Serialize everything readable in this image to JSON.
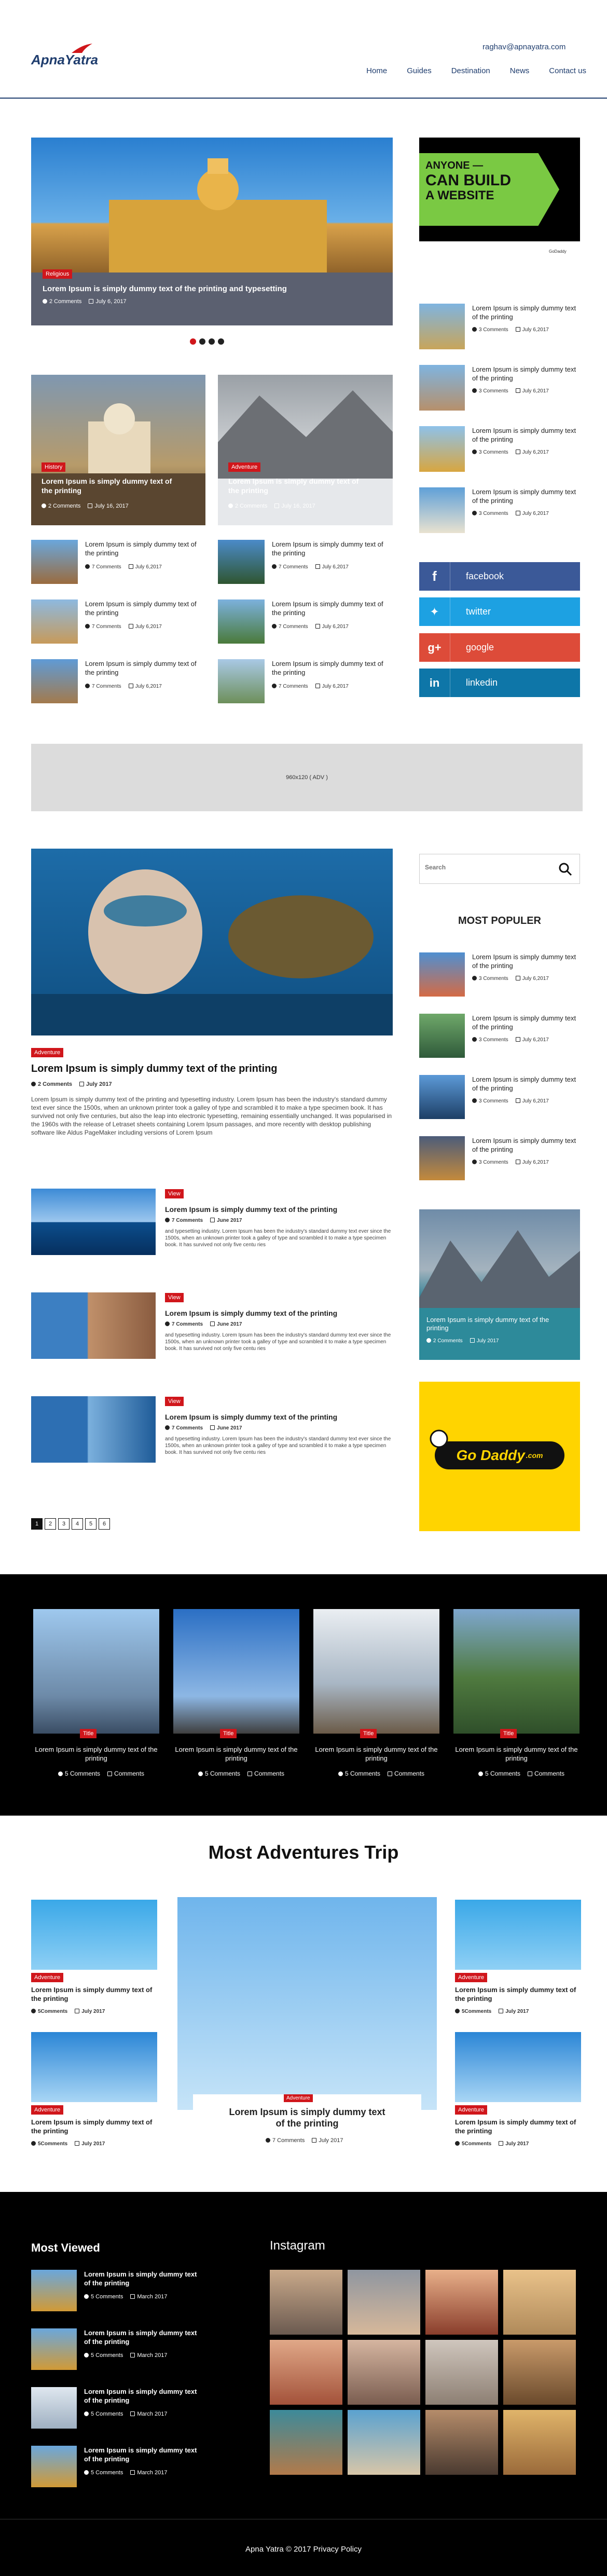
{
  "header": {
    "logo_a": "Apna",
    "logo_b": "Yatra",
    "email": "raghav@apnayatra.com",
    "nav": [
      "Home",
      "Guides",
      "Destination",
      "News",
      "Contact us"
    ]
  },
  "hero": {
    "badge": "Religious",
    "title": "Lorem Ipsum is simply dummy text of the printing and typesetting",
    "comments": "2 Comments",
    "date": "July 6, 2017"
  },
  "ad_build": {
    "line1": "ANYONE —",
    "line2": "CAN BUILD",
    "line3": "A WEBSITE",
    "brand": "GoDaddy"
  },
  "side_list": [
    {
      "title": "Lorem Ipsum is simply dummy text of the printing",
      "comments": "3 Comments",
      "date": "July 6,2017"
    },
    {
      "title": "Lorem Ipsum is simply dummy text of the printing",
      "comments": "3 Comments",
      "date": "July 6,2017"
    },
    {
      "title": "Lorem Ipsum is simply dummy text of the printing",
      "comments": "3 Comments",
      "date": "July 6,2017"
    },
    {
      "title": "Lorem Ipsum is simply dummy text of the printing",
      "comments": "3 Comments",
      "date": "July 6,2017"
    }
  ],
  "feature_cards": [
    {
      "badge": "History",
      "title": "Lorem Ipsum is simply dummy text of the printing",
      "comments": "2 Comments",
      "date": "July 16, 2017"
    },
    {
      "badge": "Adventure",
      "title": "Lorem Ipsum is simply dummy text of the printing",
      "comments": "2 Comments",
      "date": "July 16, 2017"
    }
  ],
  "small_grid": [
    {
      "title": "Lorem Ipsum is simply dummy text of the printing",
      "comments": "7 Comments",
      "date": "July 6,2017"
    },
    {
      "title": "Lorem Ipsum is simply dummy text of the printing",
      "comments": "7 Comments",
      "date": "July 6,2017"
    },
    {
      "title": "Lorem Ipsum is simply dummy text of the printing",
      "comments": "7 Comments",
      "date": "July 6,2017"
    },
    {
      "title": "Lorem Ipsum is simply dummy text of the printing",
      "comments": "7 Comments",
      "date": "July 6,2017"
    },
    {
      "title": "Lorem Ipsum is simply dummy text of the printing",
      "comments": "7 Comments",
      "date": "July 6,2017"
    },
    {
      "title": "Lorem Ipsum is simply dummy text of the printing",
      "comments": "7 Comments",
      "date": "July 6,2017"
    }
  ],
  "social": [
    "facebook",
    "twitter",
    "google",
    "linkedin"
  ],
  "ad_banner": "960x120 ( ADV )",
  "article": {
    "badge": "Adventure",
    "title": "Lorem Ipsum is simply dummy text of the printing",
    "comments": "2 Comments",
    "date": "July 2017",
    "body": "Lorem Ipsum is simply dummy text of the printing and typesetting industry. Lorem Ipsum has been the industry's standard dummy text ever since the 1500s, when an unknown printer took a galley of type and scrambled it to make a type specimen book. It has survived not only five centuries, but also the leap into electronic typesetting, remaining essentially unchanged. It was popularised in the 1960s with the release of Letraset sheets containing Lorem Ipsum passages, and more recently with desktop publishing software like Aldus PageMaker including versions of Lorem Ipsum"
  },
  "list_articles": [
    {
      "badge": "View",
      "title": "Lorem Ipsum is simply dummy text of the printing",
      "comments": "7 Comments",
      "date": "June 2017",
      "body": "and typesetting industry. Lorem Ipsum has been the industry's standard dummy text ever since the 1500s, when an unknown printer took a galley of type and scrambled it to make a type specimen book. It has survived not only five centu ries"
    },
    {
      "badge": "View",
      "title": "Lorem Ipsum is simply dummy text of the printing",
      "comments": "7 Comments",
      "date": "June 2017",
      "body": "and typesetting industry. Lorem Ipsum has been the industry's standard dummy text ever since the 1500s, when an unknown printer took a galley of type and scrambled it to make a type specimen book. It has survived not only five centu ries"
    },
    {
      "badge": "View",
      "title": "Lorem Ipsum is simply dummy text of the printing",
      "comments": "7 Comments",
      "date": "June 2017",
      "body": "and typesetting industry. Lorem Ipsum has been the industry's standard dummy text ever since the 1500s, when an unknown printer took a galley of type and scrambled it to make a type specimen book. It has survived not only five centu ries"
    }
  ],
  "pagination": [
    "1",
    "2",
    "3",
    "4",
    "5",
    "6"
  ],
  "search": {
    "placeholder": "Search"
  },
  "popular": {
    "heading": "MOST POPULER",
    "items": [
      {
        "title": "Lorem Ipsum is simply dummy text of the printing",
        "comments": "3 Comments",
        "date": "July 6,2017"
      },
      {
        "title": "Lorem Ipsum is simply dummy text of the printing",
        "comments": "3 Comments",
        "date": "July 6,2017"
      },
      {
        "title": "Lorem Ipsum is simply dummy text of the printing",
        "comments": "3 Comments",
        "date": "July 6,2017"
      },
      {
        "title": "Lorem Ipsum is simply dummy text of the printing",
        "comments": "3 Comments",
        "date": "July 6,2017"
      }
    ]
  },
  "lake_card": {
    "title": "Lorem Ipsum is simply dummy text of the printing",
    "comments": "2 Comments",
    "date": "July 2017"
  },
  "godaddy": "Go Daddy",
  "godaddy_com": ".com",
  "landmarks": [
    {
      "badge": "Title",
      "title": "Lorem Ipsum is simply dummy text of the printing",
      "comments": "5 Comments",
      "extra": "Comments"
    },
    {
      "badge": "Title",
      "title": "Lorem Ipsum is simply dummy text of the printing",
      "comments": "5 Comments",
      "extra": "Comments"
    },
    {
      "badge": "Title",
      "title": "Lorem Ipsum is simply dummy text of the printing",
      "comments": "5 Comments",
      "extra": "Comments"
    },
    {
      "badge": "Title",
      "title": "Lorem Ipsum is simply dummy text of the printing",
      "comments": "5 Comments",
      "extra": "Comments"
    }
  ],
  "adventures": {
    "heading": "Most Adventures Trip",
    "side": [
      {
        "badge": "Adventure",
        "title": "Lorem Ipsum is simply dummy text of the printing",
        "comments": "5Comments",
        "date": "July 2017"
      },
      {
        "badge": "Adventure",
        "title": "Lorem Ipsum is simply dummy text of the printing",
        "comments": "5Comments",
        "date": "July 2017"
      },
      {
        "badge": "Adventure",
        "title": "Lorem Ipsum is simply dummy text of the printing",
        "comments": "5Comments",
        "date": "July 2017"
      },
      {
        "badge": "Adventure",
        "title": "Lorem Ipsum is simply dummy text of the printing",
        "comments": "5Comments",
        "date": "July 2017"
      }
    ],
    "center": {
      "badge": "Adventure",
      "title": "Lorem Ipsum is simply dummy text of the printing",
      "comments": "7 Comments",
      "date": "July 2017"
    }
  },
  "footer": {
    "viewed_heading": "Most Viewed",
    "instagram_heading": "Instagram",
    "viewed": [
      {
        "title": "Lorem Ipsum is simply dummy text of the printing",
        "comments": "5 Comments",
        "date": "March 2017"
      },
      {
        "title": "Lorem Ipsum is simply dummy text of the printing",
        "comments": "5 Comments",
        "date": "March 2017"
      },
      {
        "title": "Lorem Ipsum is simply dummy text of the printing",
        "comments": "5 Comments",
        "date": "March 2017"
      },
      {
        "title": "Lorem Ipsum is simply dummy text of the printing",
        "comments": "5 Comments",
        "date": "March 2017"
      }
    ],
    "copyright": "Apna Yatra © 2017 Privacy Policy"
  }
}
